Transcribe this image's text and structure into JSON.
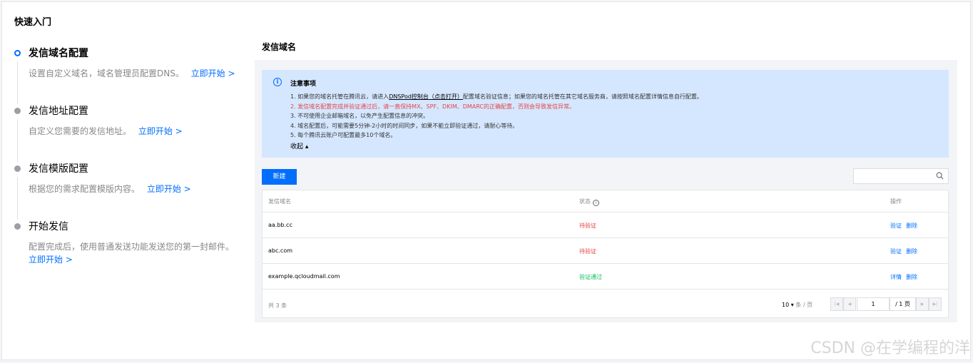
{
  "quick_start": {
    "title": "快速入门"
  },
  "steps": [
    {
      "title": "发信域名配置",
      "desc": "设置自定义域名，域名管理员配置DNS。",
      "link": "立即开始 >"
    },
    {
      "title": "发信地址配置",
      "desc": "自定义您需要的发信地址。",
      "link": "立即开始 >"
    },
    {
      "title": "发信模版配置",
      "desc": "根据您的需求配置模版内容。",
      "link": "立即开始 >"
    },
    {
      "title": "开始发信",
      "desc": "配置完成后，使用普通发送功能发送您的第一封邮件。",
      "link": "立即开始 >"
    }
  ],
  "section": {
    "title": "发信域名"
  },
  "notice": {
    "title": "注意事项",
    "line1_pre": "1. 如果您的域名托管在腾讯云，请进入",
    "line1_link": "DNSPod控制台（点击打开）",
    "line1_post": "配置域名验证信息；如果您的域名托管在其它域名服务商，请按照域名配置详情信息自行配置。",
    "line2": "2. 发信域名配置完成并验证通过后，请一直保持MX、SPF、DKIM、DMARC的正确配置，否则会导致发信异常。",
    "line3": "3. 不可使用企业邮箱域名，以免产生配置信息的冲突。",
    "line4": "4. 域名配置后，可能需要5分钟-2小时的时间同步，如果不能立即验证通过，请耐心等待。",
    "line5": "5. 每个腾讯云账户可配置最多10个域名。",
    "collapse": "收起 ▴"
  },
  "toolbar": {
    "new_label": "新建",
    "search_placeholder": ""
  },
  "table": {
    "headers": {
      "domain": "发信域名",
      "status": "状态",
      "actions": "操作"
    },
    "rows": [
      {
        "domain": "aa.bb.cc",
        "status": "待验证",
        "act1": "验证",
        "act2": "删除"
      },
      {
        "domain": "abc.com",
        "status": "待验证",
        "act1": "验证",
        "act2": "删除"
      },
      {
        "domain": "example.qcloudmail.com",
        "status": "验证通过",
        "act1": "详情",
        "act2": "删除"
      }
    ],
    "total": "共 3 条",
    "page_size": "10 ▾",
    "page_size_unit": "条 / 页",
    "page_input": "1",
    "page_total": "/ 1 页"
  },
  "watermark": "CSDN @在学编程的洋",
  "colors": {
    "accent": "#006eff",
    "danger": "#e54545",
    "success": "#0abf5b",
    "notice_bg": "#d5e7ff"
  }
}
